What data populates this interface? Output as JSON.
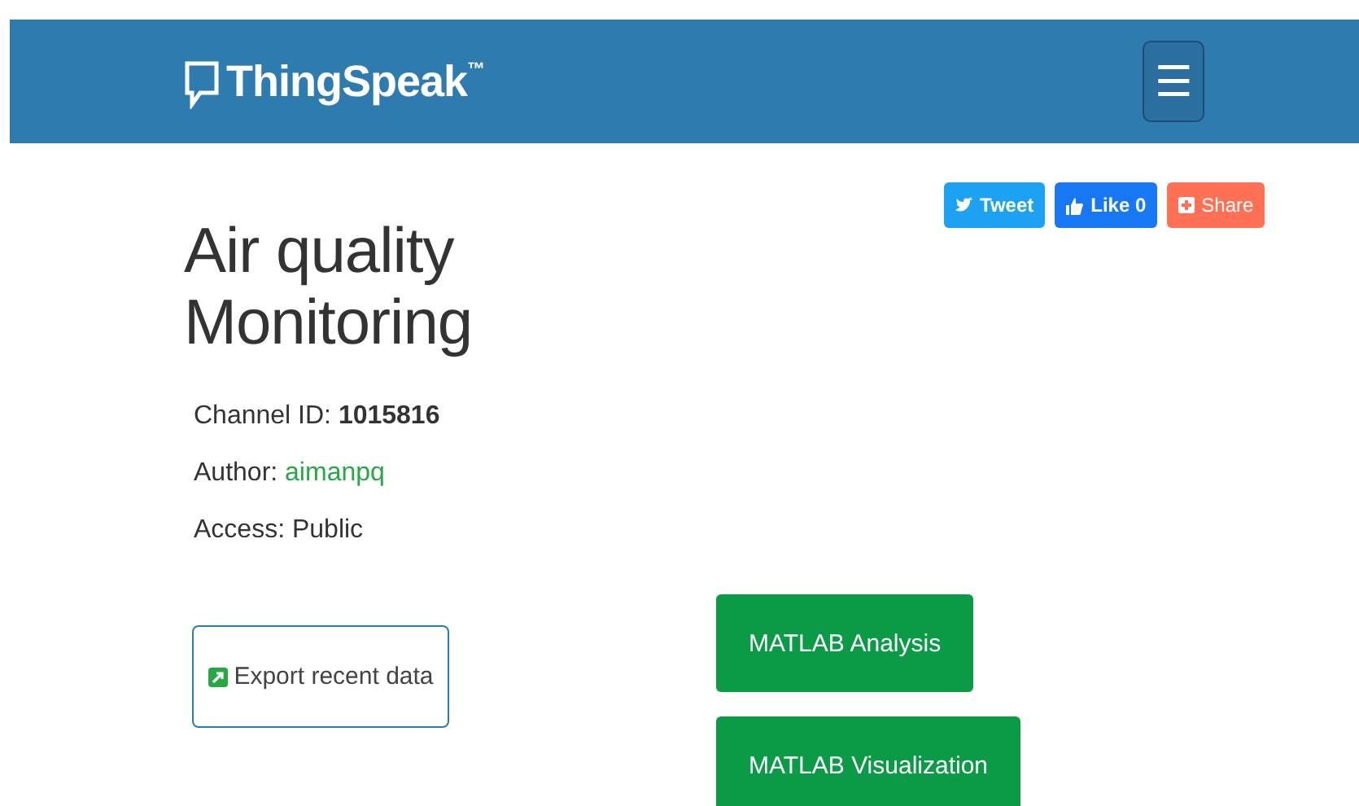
{
  "navbar": {
    "brand": "ThingSpeak",
    "trademark": "™",
    "menu_button": "☰"
  },
  "social": [
    {
      "kind": "tweet",
      "label": "Tweet"
    },
    {
      "kind": "like",
      "label": "Like 0"
    },
    {
      "kind": "share",
      "label": "Share"
    }
  ],
  "title": "Air quality Monitoring",
  "details": [
    {
      "label": "Channel ID:",
      "value": "1015816",
      "kind": "bold"
    },
    {
      "label": "Author:",
      "value": "aimanpq",
      "kind": "link"
    },
    {
      "label": "Access:",
      "value": "Public",
      "kind": "plain"
    }
  ],
  "export_button": "Export recent data",
  "matlab_buttons": [
    "MATLAB Analysis",
    "MATLAB Visualization"
  ]
}
